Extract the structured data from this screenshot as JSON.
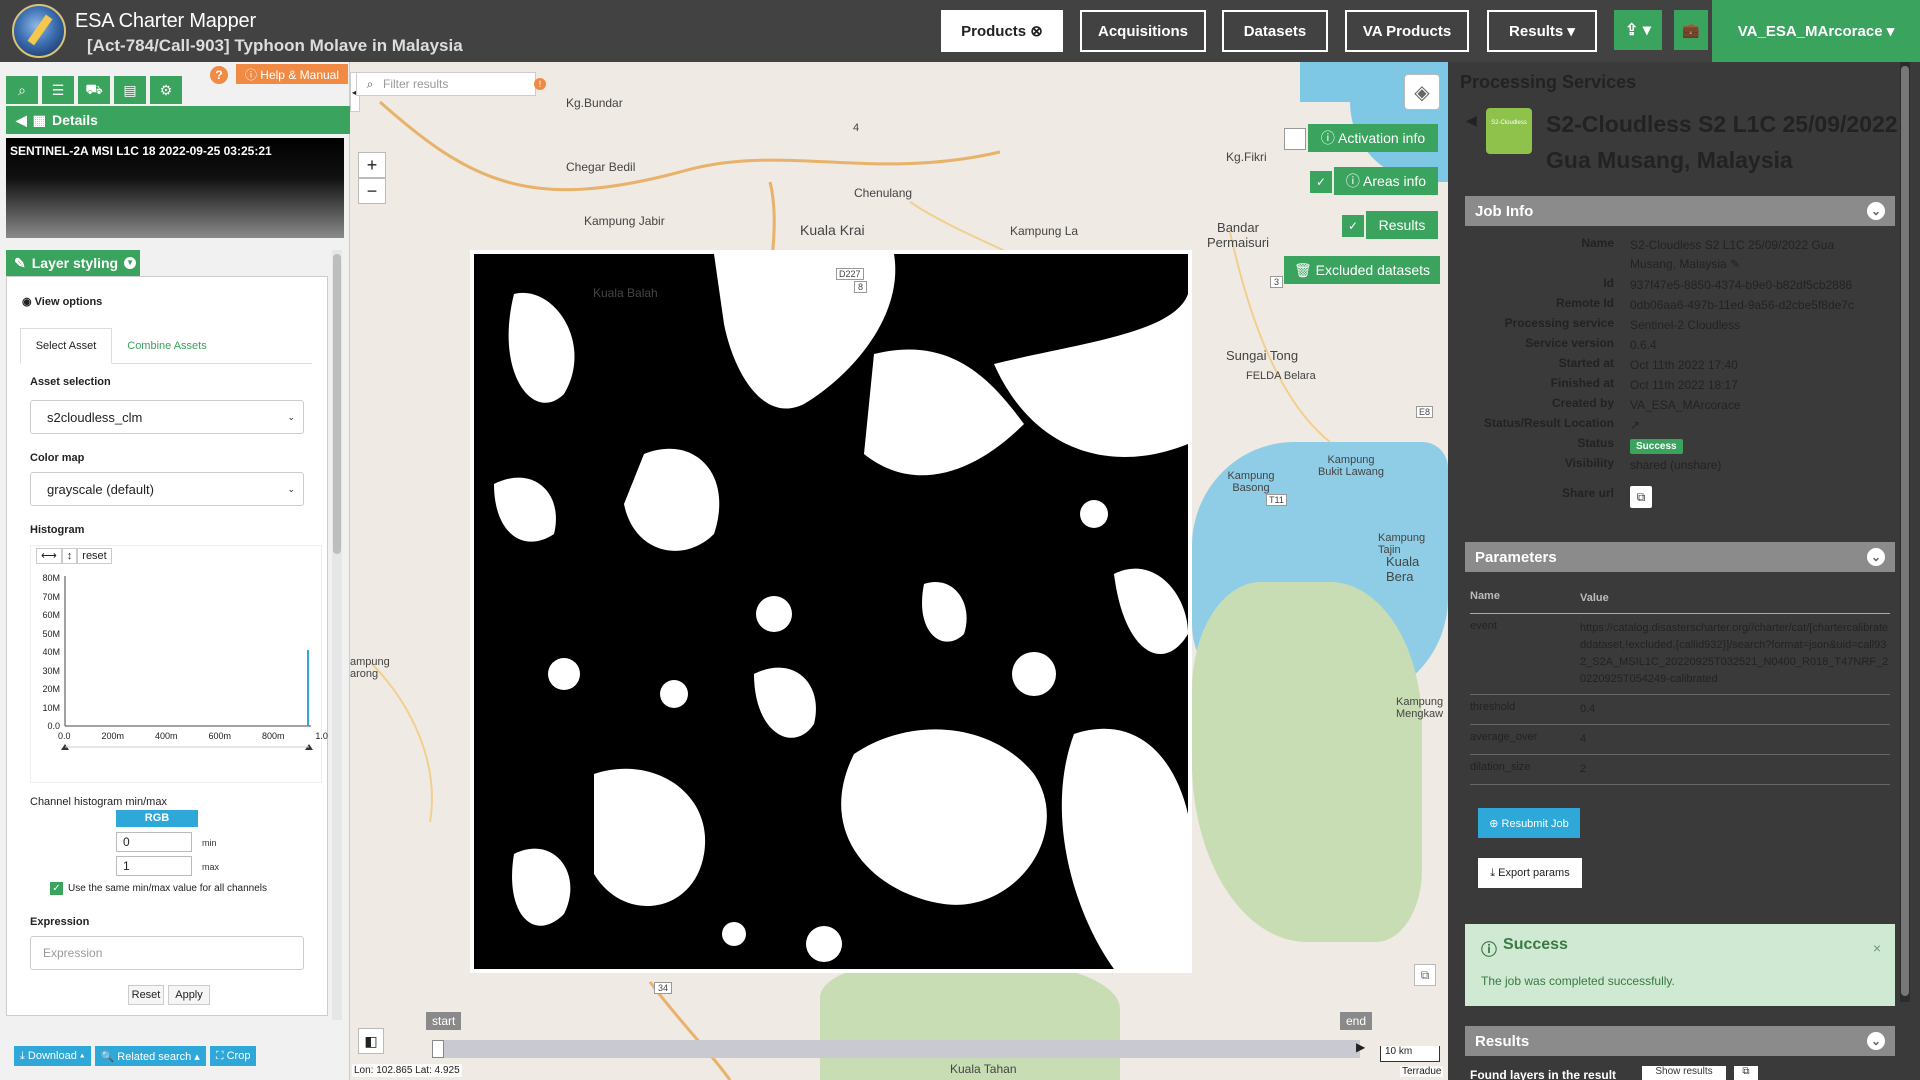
{
  "app": {
    "title": "ESA Charter Mapper",
    "subtitle": "[Act-784/Call-903] Typhoon Molave in Malaysia"
  },
  "nav": {
    "products": "Products ⊗",
    "acquisitions": "Acquisitions",
    "datasets": "Datasets",
    "va_products": "VA Products",
    "results": "Results ▾",
    "upload": "⇪ ▾",
    "briefcase": "💼",
    "user": "VA_ESA_MArcorace ▾"
  },
  "left": {
    "help": "?",
    "help_manual": "ⓘ Help & Manual",
    "details": "Details",
    "thumbnail_title": "SENTINEL-2A MSI L1C 18 2022-09-25 03:25:21",
    "layer_styling": "Layer styling",
    "view_options": "View options",
    "tabs": [
      "Select Asset",
      "Combine Assets"
    ],
    "asset_selection_label": "Asset selection",
    "asset_selection_value": "s2cloudless_clm",
    "color_map_label": "Color map",
    "color_map_value": "grayscale (default)",
    "histogram_label": "Histogram",
    "hist_reset": "reset",
    "hist_y_ticks": [
      "80M",
      "70M",
      "60M",
      "50M",
      "40M",
      "30M",
      "20M",
      "10M",
      "0.0"
    ],
    "hist_x_ticks": [
      "0.0",
      "200m",
      "400m",
      "600m",
      "800m",
      "1.0"
    ],
    "channel_label": "Channel histogram min/max",
    "rgb": "RGB",
    "min_value": "0",
    "max_value": "1",
    "min": "min",
    "max": "max",
    "same_minmax": "Use the same min/max value for all channels",
    "expression_label": "Expression",
    "expression_placeholder": "Expression",
    "reset": "Reset",
    "apply": "Apply",
    "download": "⤓ Download ▴",
    "related_search": "🔍 Related search ▴",
    "crop": "⛶ Crop"
  },
  "map": {
    "filter_placeholder": "Filter results",
    "zoom_in": "+",
    "zoom_out": "−",
    "activation_info": "ⓘ Activation info",
    "areas_info": "ⓘ Areas info",
    "results": "Results",
    "excluded_datasets": "🗑 Excluded datasets",
    "labels": {
      "chegar_bedil": "Chegar Bedil",
      "chenulang": "Chenulang",
      "kampung_jabir": "Kampung Jabir",
      "kuala_krai": "Kuala Krai",
      "kampung_la": "Kampung La",
      "bandar_permaisuri": "Bandar\nPermaisuri",
      "kg_fikri": "Kg.Fikri",
      "kg_bundar": "Kg.Bundar",
      "kuala_balah": "Kuala Balah",
      "sungai_tong": "Sungai Tong",
      "felda_belara": "FELDA Belara",
      "kampung_basong": "Kampung\nBasong",
      "kampung_bukit": "Kampung\nBukit Lawang",
      "kampung_tajin": "Kampung Tajin",
      "kuala_berang": "Kuala Bera",
      "kampung_mengkawang": "Kampung\nMengkaw",
      "kampung_left": "ampung\narong",
      "kuala_tahan": "Kuala Tahan",
      "road_4": "4",
      "road_8": "8",
      "road_d227": "D227",
      "road_3": "3",
      "road_e8": "E8",
      "road_t11": "T11",
      "road_34": "34"
    },
    "timeline_start": "start",
    "timeline_end": "end",
    "scale": "10 km",
    "coords": "Lon: 102.865 Lat: 4.925",
    "attribution": "Terradue"
  },
  "right": {
    "panel_title": "Processing Services",
    "service_icon_text": "S2-Cloudless",
    "job_title": "S2-Cloudless S2 L1C 25/09/2022 Gua Musang, Malaysia",
    "job_info": "Job Info",
    "fields": [
      {
        "k": "Name",
        "v": "S2-Cloudless S2 L1C 25/09/2022 Gua Musang, Malaysia ✎"
      },
      {
        "k": "Id",
        "v": "937f47e5-8850-4374-b9e0-b82df5cb2886"
      },
      {
        "k": "Remote Id",
        "v": "0db06aa6-497b-11ed-9a56-d2cbe5f8de7c"
      },
      {
        "k": "Processing service",
        "v": "Sentinel-2 Cloudless"
      },
      {
        "k": "Service version",
        "v": "0.6.4"
      },
      {
        "k": "Started at",
        "v": "Oct 11th 2022 17:40"
      },
      {
        "k": "Finished at",
        "v": "Oct 11th 2022 18:17"
      },
      {
        "k": "Created by",
        "v": "VA_ESA_MArcorace"
      },
      {
        "k": "Status/Result Location",
        "v": "↗"
      }
    ],
    "status_label": "Status",
    "status_value": "Success",
    "visibility_label": "Visibility",
    "visibility_value": "shared (unshare)",
    "share_url_label": "Share url",
    "parameters": "Parameters",
    "param_name_h": "Name",
    "param_value_h": "Value",
    "params": [
      {
        "k": "event",
        "v": "https://catalog.disasterscharter.org//charter/cat/[chartercalibrateddataset,!excluded,{callid932}]/search?format=json&uid=call932_S2A_MSIL1C_20220925T032521_N0400_R018_T47NRF_20220925T054249-calibrated"
      },
      {
        "k": "threshold",
        "v": "0.4"
      },
      {
        "k": "average_over",
        "v": "4"
      },
      {
        "k": "dilation_size",
        "v": "2"
      }
    ],
    "resubmit": "⊕ Resubmit Job",
    "export_params": "⤓ Export params",
    "success_title": "Success",
    "success_msg": "The job was completed successfully.",
    "success_close": "×",
    "results_head": "Results",
    "found_layers": "Found layers in the result",
    "show_results": "Show results"
  }
}
